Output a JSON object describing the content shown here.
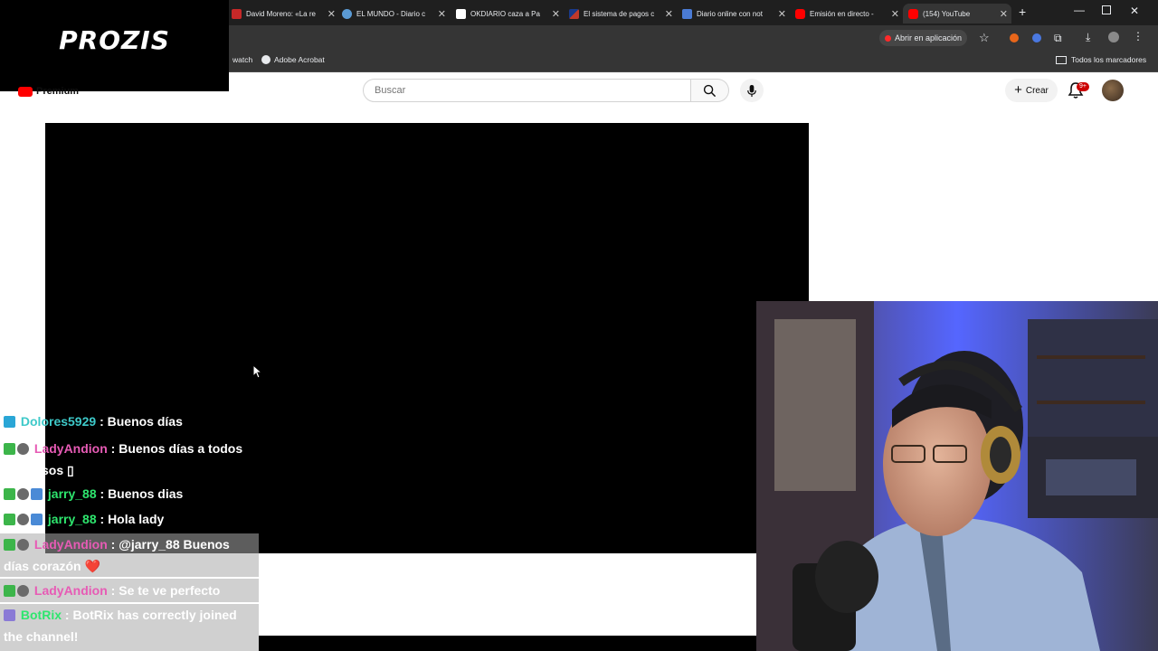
{
  "browser": {
    "tabs": [
      {
        "title": "David Moreno: «La re",
        "color": "#e33"
      },
      {
        "title": "EL MUNDO - Diario c",
        "color": "#5b9bd5"
      },
      {
        "title": "OKDIARIO caza a Pa",
        "color": "#fff"
      },
      {
        "title": "El sistema de pagos c",
        "color": "#c0392b"
      },
      {
        "title": "Diario online con not",
        "color": "#4a7bd5"
      },
      {
        "title": "Emisión en directo -",
        "color": "#e33"
      },
      {
        "title": "(154) YouTube",
        "color": "#e33"
      }
    ],
    "open_in_app": "Abrir en aplicación",
    "bookmarks": {
      "watch": "watch",
      "acrobat": "Adobe Acrobat",
      "all": "Todos los marcadores"
    }
  },
  "overlay": {
    "logo": "PROZIS"
  },
  "youtube": {
    "premium_label": "Premium",
    "search_placeholder": "Buscar",
    "create_label": "Crear",
    "notification_count": "9+"
  },
  "chat": [
    {
      "user": "Dolores5929",
      "user_color": "#3ec9c9",
      "text": "Buenos días",
      "cont": ""
    },
    {
      "user": "LadyAndion",
      "user_color": "#e75bb5",
      "text": "Buenos días a todos",
      "cont": "preciosos ▯"
    },
    {
      "user": "jarry_88",
      "user_color": "#2ee66e",
      "text": "Buenos dias",
      "cont": ""
    },
    {
      "user": "jarry_88",
      "user_color": "#2ee66e",
      "text": "Hola lady",
      "cont": ""
    },
    {
      "user": "LadyAndion",
      "user_color": "#e75bb5",
      "text": "@jarry_88 Buenos",
      "cont": "días corazón ❤️"
    },
    {
      "user": "LadyAndion",
      "user_color": "#e75bb5",
      "text": "Se te ve perfecto",
      "cont": ""
    },
    {
      "user": "BotRix",
      "user_color": "#2ee66e",
      "text": "BotRix has correctly joined",
      "cont": "the channel!"
    }
  ],
  "colors": {
    "chrome_dark": "#1f1f1f",
    "youtube_red": "#ff0000"
  }
}
